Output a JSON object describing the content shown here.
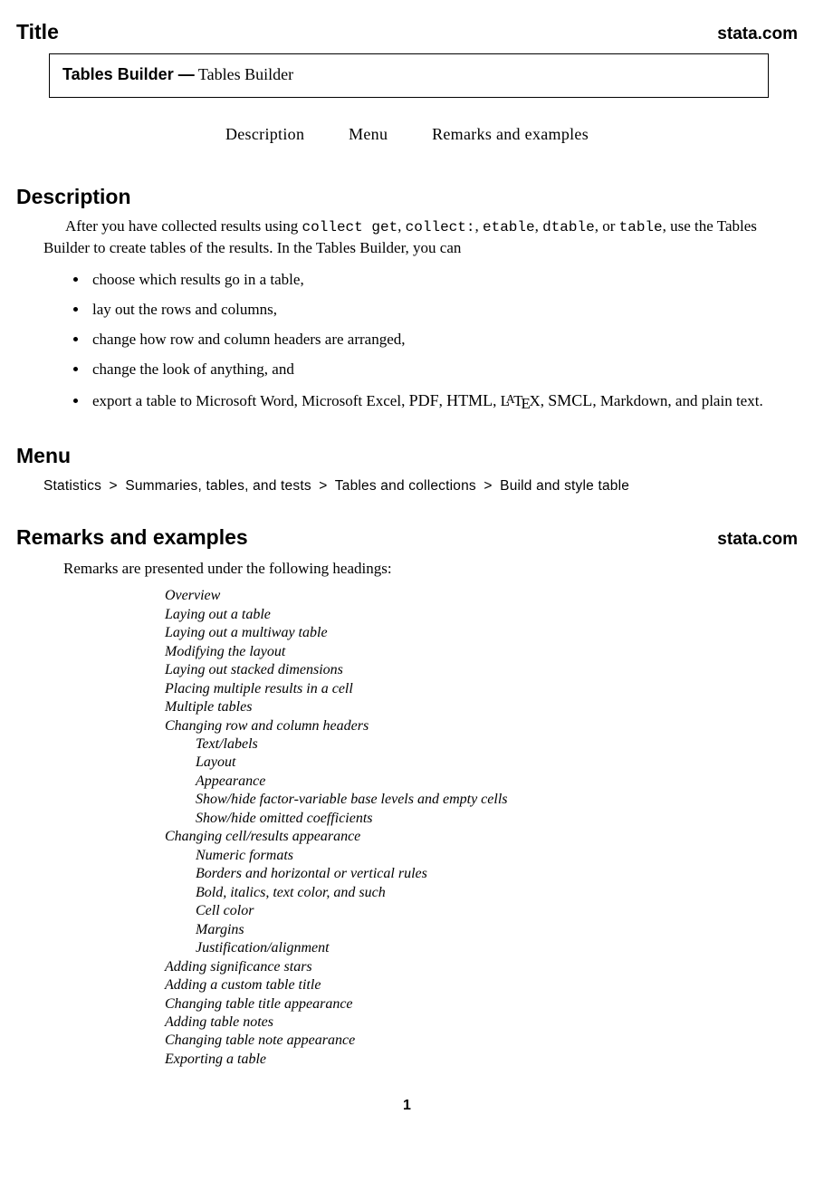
{
  "title_section": {
    "heading": "Title",
    "stata": "stata.com",
    "box_bold": "Tables Builder —",
    "box_regular": " Tables Builder"
  },
  "toc": {
    "description": "Description",
    "menu": "Menu",
    "remarks": "Remarks and examples"
  },
  "description": {
    "heading": "Description",
    "para_pre": "After you have collected results using ",
    "cmds": [
      "collect get",
      "collect:",
      "etable",
      "dtable",
      "table"
    ],
    "para_post": ", use the Tables Builder to create tables of the results. In the Tables Builder, you can",
    "bullets": [
      "choose which results go in a table,",
      "lay out the rows and columns,",
      "change how row and column headers are arranged,",
      "change the look of anything, and"
    ],
    "export_pre": "export a table to Microsoft Word, Microsoft Excel, ",
    "export_pdf": "PDF",
    "export_html": "HTML",
    "export_smcl": "SMCL",
    "export_post": ", Markdown, and plain text."
  },
  "menu": {
    "heading": "Menu",
    "path": [
      "Statistics",
      "Summaries, tables, and tests",
      "Tables and collections",
      "Build and style table"
    ]
  },
  "remarks": {
    "heading": "Remarks and examples",
    "stata": "stata.com",
    "intro": "Remarks are presented under the following headings:",
    "items": [
      {
        "t": "Overview",
        "l": 0
      },
      {
        "t": "Laying out a table",
        "l": 0
      },
      {
        "t": "Laying out a multiway table",
        "l": 0
      },
      {
        "t": "Modifying the layout",
        "l": 0
      },
      {
        "t": "Laying out stacked dimensions",
        "l": 0
      },
      {
        "t": "Placing multiple results in a cell",
        "l": 0
      },
      {
        "t": "Multiple tables",
        "l": 0
      },
      {
        "t": "Changing row and column headers",
        "l": 0
      },
      {
        "t": "Text/labels",
        "l": 1
      },
      {
        "t": "Layout",
        "l": 1
      },
      {
        "t": "Appearance",
        "l": 1
      },
      {
        "t": "Show/hide factor-variable base levels and empty cells",
        "l": 1
      },
      {
        "t": "Show/hide omitted coefficients",
        "l": 1
      },
      {
        "t": "Changing cell/results appearance",
        "l": 0
      },
      {
        "t": "Numeric formats",
        "l": 1
      },
      {
        "t": "Borders and horizontal or vertical rules",
        "l": 1
      },
      {
        "t": "Bold, italics, text color, and such",
        "l": 1
      },
      {
        "t": "Cell color",
        "l": 1
      },
      {
        "t": "Margins",
        "l": 1
      },
      {
        "t": "Justification/alignment",
        "l": 1
      },
      {
        "t": "Adding significance stars",
        "l": 0
      },
      {
        "t": "Adding a custom table title",
        "l": 0
      },
      {
        "t": "Changing table title appearance",
        "l": 0
      },
      {
        "t": "Adding table notes",
        "l": 0
      },
      {
        "t": "Changing table note appearance",
        "l": 0
      },
      {
        "t": "Exporting a table",
        "l": 0
      }
    ]
  },
  "page_number": "1"
}
